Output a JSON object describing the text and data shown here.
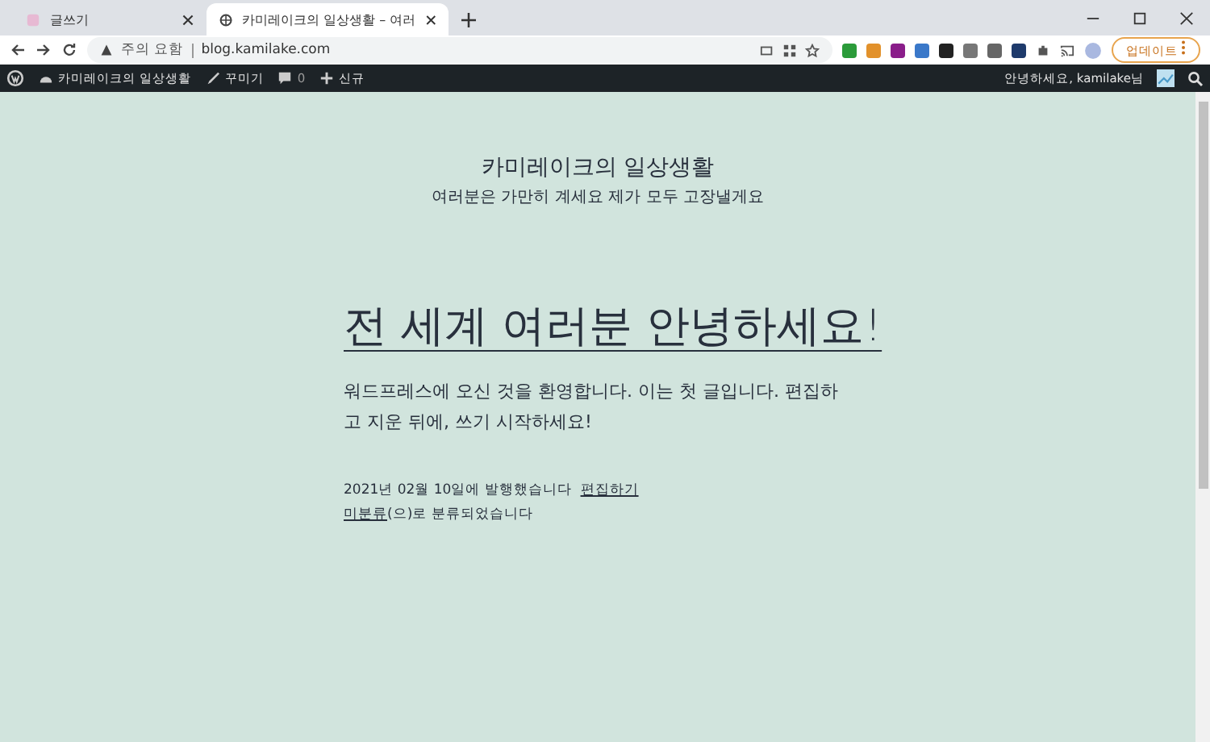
{
  "browser": {
    "tabs": [
      {
        "title": "글쓰기",
        "selected": false
      },
      {
        "title": "카미레이크의 일상생활 – 여러",
        "selected": true
      }
    ],
    "security_label": "주의 요함",
    "url": "blog.kamilake.com",
    "update_button": "업데이트"
  },
  "admin_bar": {
    "site_name": "카미레이크의 일상생활",
    "customize": "꾸미기",
    "comments": "0",
    "new": "신규",
    "greeting": "안녕하세요, kamilake님"
  },
  "site": {
    "title": "카미레이크의 일상생활",
    "tagline": "여러분은 가만히 계세요 제가 모두 고장낼게요"
  },
  "post": {
    "title": "전 세계 여러분 안녕하세요!",
    "body": "워드프레스에 오신 것을 환영합니다. 이는 첫 글입니다. 편집하고 지운 뒤에, 쓰기 시작하세요!",
    "published": "2021년 02월 10일에 발행했습니다",
    "edit_link": "편집하기",
    "category": "미분류",
    "category_suffix": "(으)로 분류되었습니다"
  }
}
